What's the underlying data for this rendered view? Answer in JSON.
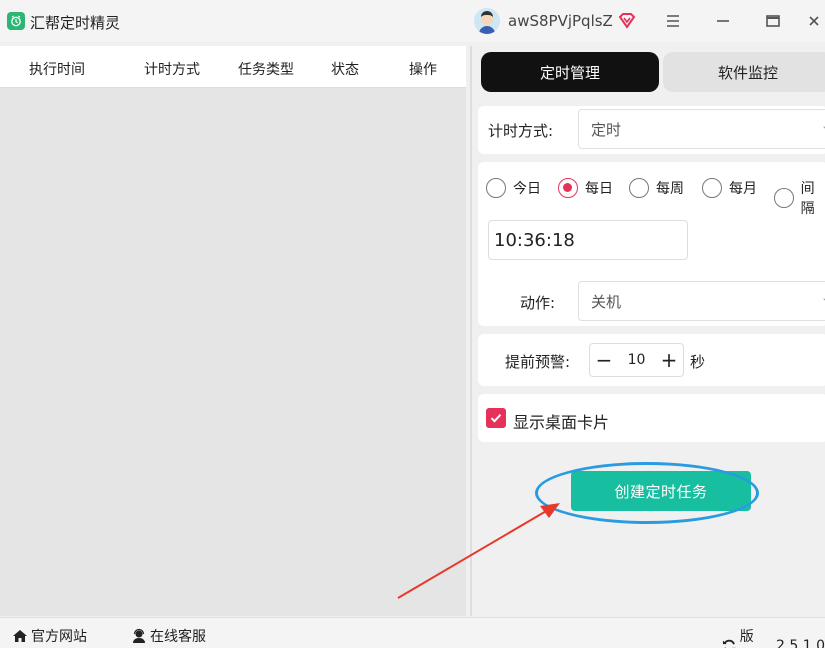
{
  "app": {
    "title": "汇帮定时精灵",
    "username": "awS8PVjPqlsZ"
  },
  "table": {
    "headers": [
      "执行时间",
      "计时方式",
      "任务类型",
      "状态",
      "操作"
    ]
  },
  "tabs": {
    "active": "定时管理",
    "inactive": "软件监控"
  },
  "timing": {
    "label": "计时方式:",
    "value": "定时"
  },
  "frequency": {
    "options": [
      "今日",
      "每日",
      "每周",
      "每月",
      "间隔"
    ],
    "selected": "每日"
  },
  "time_value": "10:36:18",
  "action": {
    "label": "动作:",
    "value": "关机"
  },
  "warning": {
    "label": "提前预警:",
    "minus": "−",
    "value": "10",
    "plus": "+",
    "unit": "秒"
  },
  "show_card": {
    "label": "显示桌面卡片",
    "checked": true
  },
  "create_button": "创建定时任务",
  "footer": {
    "website": "官方网站",
    "support": "在线客服",
    "version_label": "版本:",
    "version": "2.5.1.0"
  },
  "colors": {
    "accent": "#e6325a",
    "primary_button": "#17bfa0",
    "highlight": "#2a9be0",
    "arrow": "#e53a2b"
  }
}
